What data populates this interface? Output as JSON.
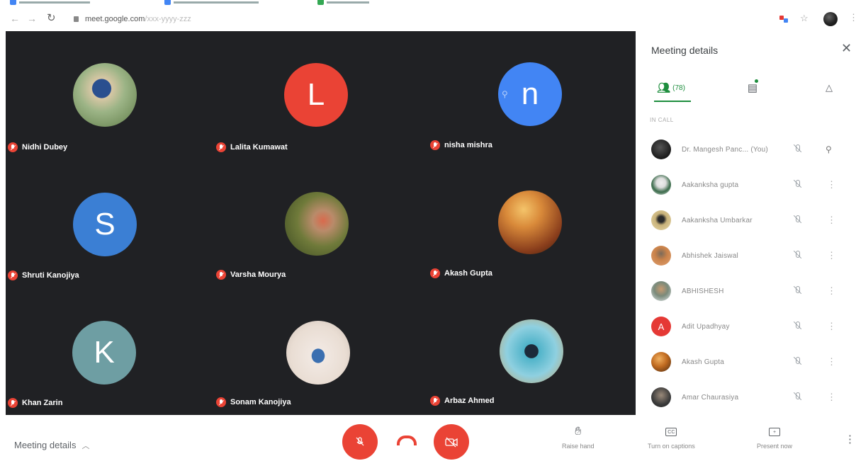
{
  "browser": {
    "bookmarks": [
      "",
      "",
      ""
    ],
    "url_host": "meet.google.com",
    "url_path": "/xxx-yyyy-zzz"
  },
  "grid": {
    "participants": [
      {
        "name": "Nidhi Dubey",
        "initial": "",
        "avatar_color": "#7a9a66",
        "photo": true
      },
      {
        "name": "Lalita Kumawat",
        "initial": "L",
        "avatar_color": "#ea4335",
        "photo": false
      },
      {
        "name": "nisha mishra",
        "initial": "n",
        "avatar_color": "#4285f4",
        "photo": false
      },
      {
        "name": "Shruti Kanojiya",
        "initial": "S",
        "avatar_color": "#3b7fd4",
        "photo": false
      },
      {
        "name": "Varsha Mourya",
        "initial": "",
        "avatar_color": "#5e6b3a",
        "photo": true
      },
      {
        "name": "Akash Gupta",
        "initial": "",
        "avatar_color": "#b5661a",
        "photo": true
      },
      {
        "name": "Khan Zarin",
        "initial": "K",
        "avatar_color": "#6e9ea3",
        "photo": false
      },
      {
        "name": "Sonam Kanojiya",
        "initial": "",
        "avatar_color": "#e6d9d0",
        "photo": true
      },
      {
        "name": "Arbaz Ahmed",
        "initial": "",
        "avatar_color": "#3e7d8c",
        "photo": true
      }
    ]
  },
  "panel": {
    "title": "Meeting details",
    "people_count": "(78)",
    "in_call_label": "IN CALL",
    "people": [
      {
        "name": "Dr. Mangesh Panc... (You)",
        "initial": "",
        "color": "#222222"
      },
      {
        "name": "Aakanksha gupta",
        "initial": "",
        "color": "#4a6a5a"
      },
      {
        "name": "Aakanksha Umbarkar",
        "initial": "",
        "color": "#8a7a55"
      },
      {
        "name": "Abhishek Jaiswal",
        "initial": "",
        "color": "#b9794a"
      },
      {
        "name": "ABHISHESH",
        "initial": "",
        "color": "#6c8a9a"
      },
      {
        "name": "Adit Upadhyay",
        "initial": "A",
        "color": "#e53935"
      },
      {
        "name": "Akash Gupta",
        "initial": "",
        "color": "#c07020"
      },
      {
        "name": "Amar Chaurasiya",
        "initial": "",
        "color": "#4a4a4a"
      }
    ]
  },
  "bottom": {
    "meeting_details": "Meeting details",
    "raise_hand": "Raise hand",
    "captions": "Turn on captions",
    "captions_glyph": "CC",
    "present": "Present now"
  },
  "colors": {
    "accent": "#1e8e3e",
    "danger": "#ea4335",
    "stage": "#202124"
  }
}
